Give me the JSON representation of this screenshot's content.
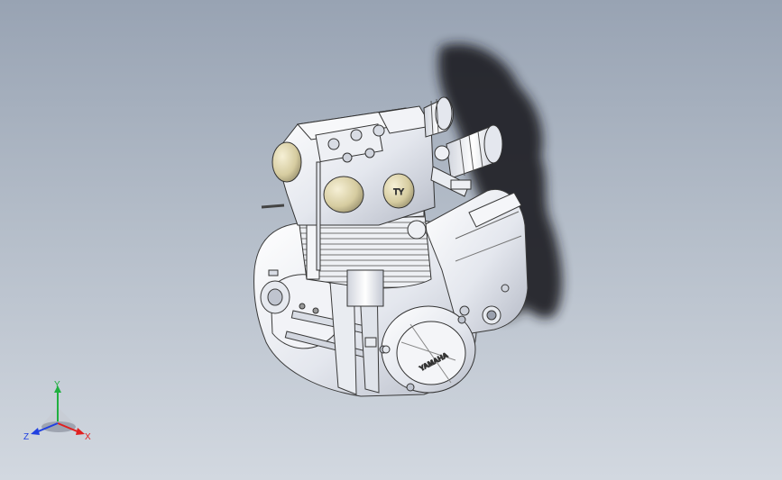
{
  "viewport": {
    "background_top": "#98a3b3",
    "background_bottom": "#d2d8e0"
  },
  "model": {
    "icon": "engine-model",
    "brand_text": "YAMAHA",
    "cover_emblem": "TY",
    "shadow_color": "#1e1e22"
  },
  "triad": {
    "x_label": "X",
    "y_label": "Y",
    "z_label": "Z",
    "x_color": "#e02020",
    "y_color": "#20b040",
    "z_color": "#2040e0"
  }
}
